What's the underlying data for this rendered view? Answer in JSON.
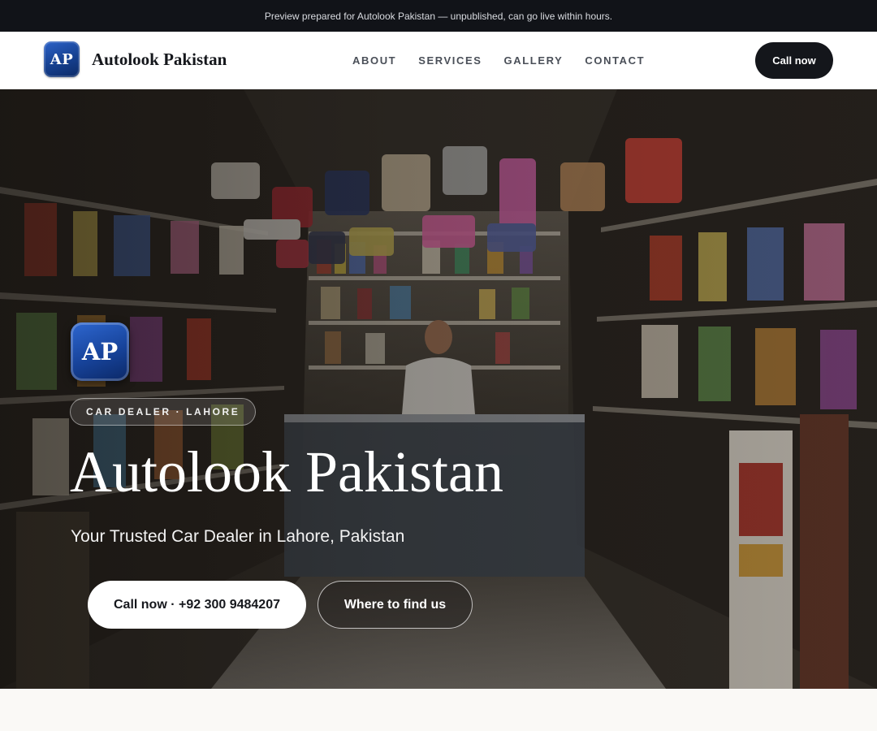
{
  "banner": {
    "text": "Preview prepared for Autolook Pakistan — unpublished, can go live within hours."
  },
  "header": {
    "logo_initials": "AP",
    "brand_name": "Autolook Pakistan",
    "nav": [
      {
        "label": "ABOUT"
      },
      {
        "label": "SERVICES"
      },
      {
        "label": "GALLERY"
      },
      {
        "label": "CONTACT"
      }
    ],
    "call_label": "Call now"
  },
  "hero": {
    "logo_initials": "AP",
    "tag": "CAR DEALER · LAHORE",
    "title": "Autolook Pakistan",
    "subtitle": "Your Trusted Car Dealer in Lahore, Pakistan",
    "primary_cta": "Call now · +92 300 9484207",
    "secondary_cta": "Where to find us",
    "background_image": "shop-interior-photo"
  },
  "colors": {
    "banner_bg": "#111318",
    "header_bg": "#ffffff",
    "brand_blue": "#17439a",
    "dark_button": "#14161b",
    "page_bg": "#faf9f6"
  }
}
